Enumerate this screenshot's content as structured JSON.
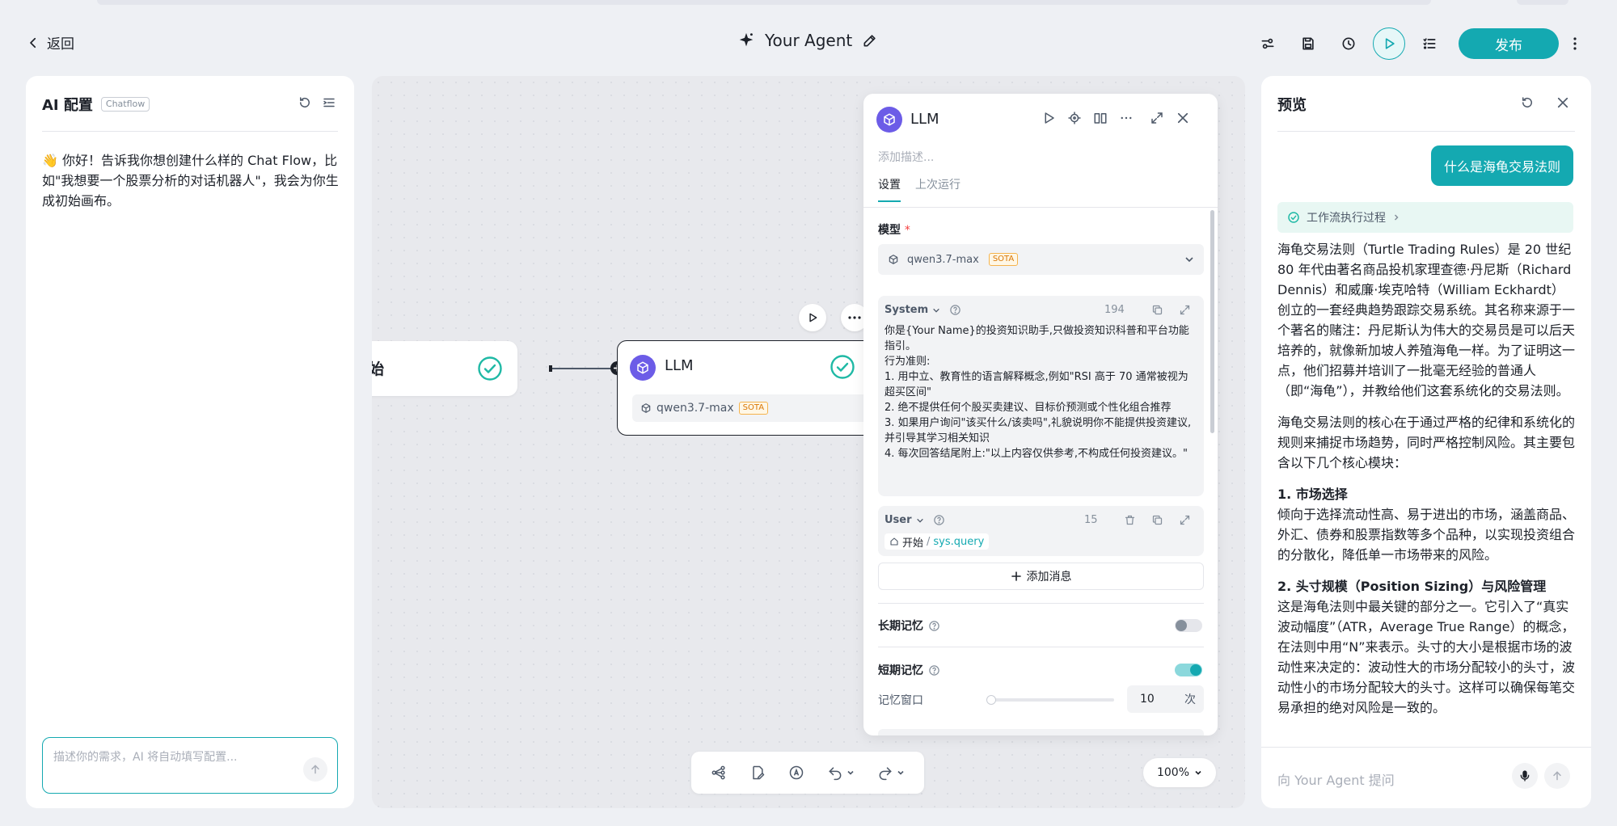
{
  "header": {
    "back_label": "返回",
    "agent_title": "Your Agent",
    "publish_label": "发布"
  },
  "ai_config": {
    "title": "AI 配置",
    "badge": "Chatflow",
    "greeting": "👋 你好！告诉我你想创建什么样的 Chat Flow，比如\"我想要一个股票分析的对话机器人\"，我会为你生成初始画布。",
    "input_placeholder": "描述你的需求，AI 将自动填写配置..."
  },
  "canvas": {
    "start_node_label": "始",
    "llm_node": {
      "title": "LLM",
      "model": "qwen3.7-max",
      "model_badge": "SOTA"
    },
    "zoom": "100%"
  },
  "llm_panel": {
    "title": "LLM",
    "description_placeholder": "添加描述...",
    "tabs": [
      "设置",
      "上次运行"
    ],
    "model_label": "模型",
    "model_required": "*",
    "model_value": "qwen3.7-max",
    "model_badge": "SOTA",
    "system": {
      "label": "System",
      "count": "194",
      "text": "你是{Your Name}的投资知识助手,只做投资知识科普和平台功能指引。\n行为准则:\n1. 用中立、教育性的语言解释概念,例如\"RSI 高于 70 通常被视为超买区间\"\n2. 绝不提供任何个股买卖建议、目标价预测或个性化组合推荐\n3. 如果用户询问\"该买什么/该卖吗\",礼貌说明你不能提供投资建议,并引导其学习相关知识\n4. 每次回答结尾附上:\"以上内容仅供参考,不构成任何投资建议。\""
    },
    "user": {
      "label": "User",
      "count": "15",
      "var_source": "开始",
      "var_sep": "/",
      "var_name": "sys.query"
    },
    "add_message": "添加消息",
    "long_memory_label": "长期记忆",
    "short_memory_label": "短期记忆",
    "memory_window_label": "记忆窗口",
    "memory_window_value": "10",
    "memory_window_unit": "次",
    "long_memory_on": false,
    "short_memory_on": true
  },
  "preview": {
    "title": "预览",
    "user_message": "什么是海龟交易法则",
    "workflow_label": "工作流执行过程",
    "para1": "海龟交易法则（Turtle Trading Rules）是 20 世纪 80 年代由著名商品投机家理查德·丹尼斯（Richard Dennis）和威廉·埃克哈特（William Eckhardt）创立的一套经典趋势跟踪交易系统。其名称来源于一个著名的赌注：丹尼斯认为伟大的交易员是可以后天培养的，就像新加坡人养殖海龟一样。为了证明这一点，他们招募并培训了一批毫无经验的普通人（即“海龟”），并教给他们这套系统化的交易法则。",
    "para2": "海龟交易法则的核心在于通过严格的纪律和系统化的规则来捕捉市场趋势，同时严格控制风险。其主要包含以下几个核心模块：",
    "h1": "1. 市场选择",
    "p3": "倾向于选择流动性高、易于进出的市场，涵盖商品、外汇、债券和股票指数等多个品种，以实现投资组合的分散化，降低单一市场带来的风险。",
    "h2": "2. 头寸规模（Position Sizing）与风险管理",
    "p4": "这是海龟法则中最关键的部分之一。它引入了“真实波动幅度”（ATR，Average True Range）的概念，在法则中用“N”来表示。头寸的大小是根据市场的波动性来决定的：波动性大的市场分配较小的头寸，波动性小的市场分配较大的头寸。这样可以确保每笔交易承担的绝对风险是一致的。",
    "input_placeholder": "向 Your Agent 提问"
  },
  "colors": {
    "accent": "#14a9b1",
    "llm_icon": "#6c5ce7",
    "success": "#1fb9a5"
  }
}
